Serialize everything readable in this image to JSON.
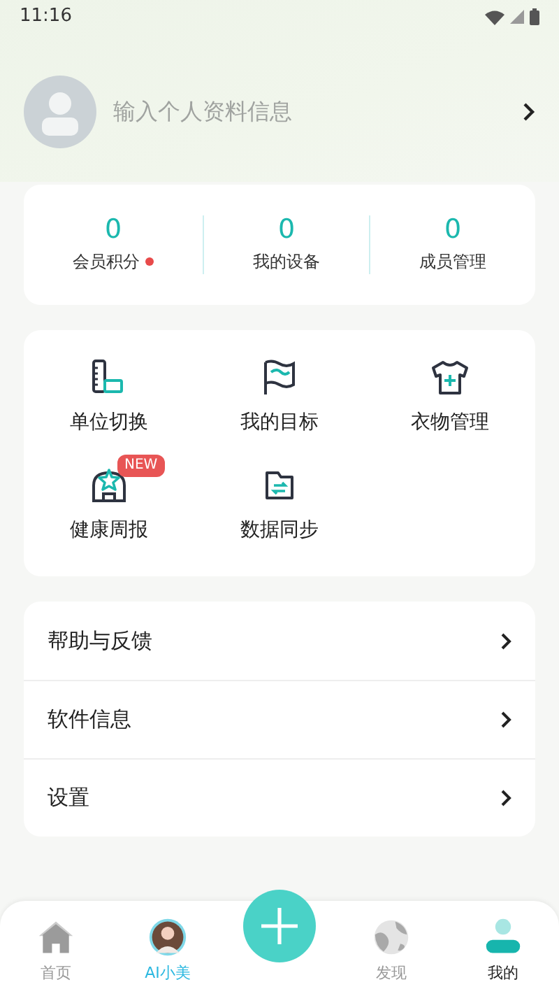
{
  "status_bar": {
    "time": "11:16"
  },
  "profile": {
    "placeholder": "输入个人资料信息"
  },
  "stats": [
    {
      "value": "0",
      "label": "会员积分",
      "dot": true
    },
    {
      "value": "0",
      "label": "我的设备",
      "dot": false
    },
    {
      "value": "0",
      "label": "成员管理",
      "dot": false
    }
  ],
  "features": [
    {
      "kind": "ruler",
      "label": "单位切换"
    },
    {
      "kind": "flag",
      "label": "我的目标"
    },
    {
      "kind": "shirt",
      "label": "衣物管理"
    },
    {
      "kind": "report",
      "label": "健康周报",
      "badge": "NEW"
    },
    {
      "kind": "sync",
      "label": "数据同步"
    }
  ],
  "menu": [
    {
      "label": "帮助与反馈"
    },
    {
      "label": "软件信息"
    },
    {
      "label": "设置"
    }
  ],
  "tabs": [
    {
      "kind": "home",
      "label": "首页",
      "selected": false
    },
    {
      "kind": "avatar",
      "label": "AI小美",
      "selected": false
    },
    {
      "kind": "plus",
      "selected": false
    },
    {
      "kind": "discover",
      "label": "发现",
      "selected": false
    },
    {
      "kind": "me",
      "label": "我的",
      "selected": true
    }
  ]
}
